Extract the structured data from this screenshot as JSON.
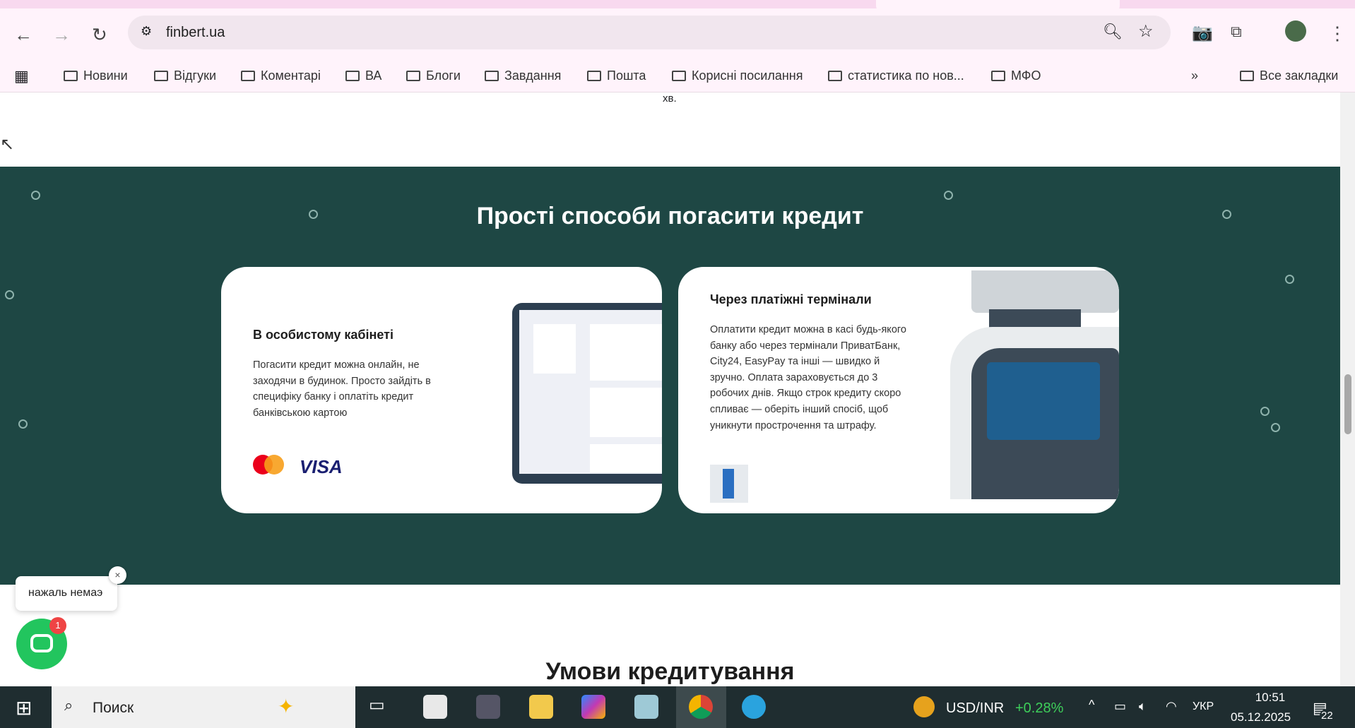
{
  "browser": {
    "url": "finbert.ua",
    "bookmarks": [
      "Новини",
      "Відгуки",
      "Коментарі",
      "ВА",
      "Блоги",
      "Завдання",
      "Пошта",
      "Корисні посилання",
      "статистика по нов...",
      "МФО"
    ],
    "all_bookmarks": "Все закладки",
    "overflow": "»"
  },
  "page": {
    "top_fragment": "хв.",
    "section_title": "Прості способи погасити кредит",
    "cards": [
      {
        "title": "В особистому кабінеті",
        "text": "Погасити кредит можна онлайн, не заходячи в будинок. Просто зайдіть в специфіку банку і оплатіть кредит банківською картою",
        "logos": [
          "mastercard",
          "VISA"
        ]
      },
      {
        "title": "Через платіжні термінали",
        "text": "Оплатити кредит можна в касі будь-якого банку або через термінали ПриватБанк, City24, EasyPay та інші — швидко й зручно. Оплата зараховується до 3 робочих днів. Якщо строк кредиту скоро спливає — оберіть інший спосіб, щоб уникнути прострочення та штрафу."
      }
    ],
    "next_title": "Умови кредитування",
    "chat": {
      "bubble": "нажаль немаэ",
      "badge": "1",
      "close": "×"
    },
    "colors": {
      "section_bg": "#1e4744",
      "chat": "#22c55e"
    }
  },
  "taskbar": {
    "search": "Поиск",
    "ticker": "USD/INR",
    "change": "+0.28%",
    "lang": "УКР",
    "time": "10:51",
    "date": "05.12.2025",
    "notifications": "22"
  }
}
